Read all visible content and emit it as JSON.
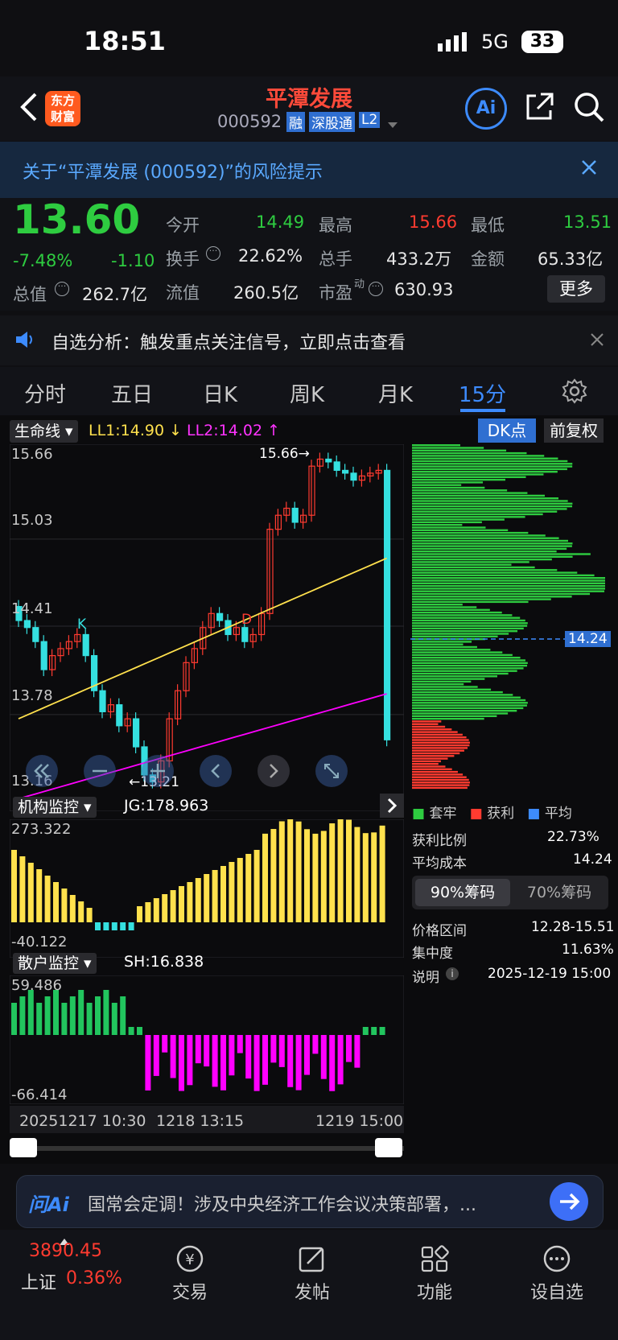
{
  "status": {
    "time": "18:51",
    "network": "5G",
    "battery": "33"
  },
  "header": {
    "logo_line1": "东方",
    "logo_line2": "财富",
    "title": "平潭发展",
    "code": "000592",
    "tag_margin": "融",
    "tag_connect": "深股通",
    "tag_level": "L2",
    "ai_label": "Ai"
  },
  "banner": {
    "text": "关于“平潭发展 (000592)”的风险提示"
  },
  "quote": {
    "price": "13.60",
    "change_pct": "-7.48%",
    "change": "-1.10",
    "open_label": "今开",
    "open": "14.49",
    "high_label": "最高",
    "high": "15.66",
    "low_label": "最低",
    "low": "13.51",
    "turnover_label": "换手",
    "turnover": "22.62%",
    "volume_label": "总手",
    "volume": "433.2万",
    "amount_label": "金额",
    "amount": "65.33亿",
    "mcap_label": "总值",
    "mcap": "262.7亿",
    "float_label": "流值",
    "float": "260.5亿",
    "pe_label": "市盈",
    "pe_sup": "动",
    "pe": "630.93",
    "more": "更多"
  },
  "notice": {
    "text": "自选分析：触发重点关注信号，立即点击查看"
  },
  "tabs": [
    "分时",
    "五日",
    "日K",
    "周K",
    "月K",
    "15分"
  ],
  "chart": {
    "indicator": "生命线",
    "ll1": "LL1:14.90",
    "ll2": "LL2:14.02",
    "dk": "DK点",
    "adjust": "前复权",
    "y_labels": [
      "15.66",
      "15.03",
      "14.41",
      "13.78",
      "13.16"
    ],
    "high_mark": "15.66",
    "low_mark": "13.21",
    "marker_k": "K",
    "marker_d": "D",
    "cost_tag": "14.24"
  },
  "chart_data": {
    "type": "candlestick",
    "y_range": [
      13.16,
      15.66
    ],
    "institution": {
      "name": "机构监控",
      "value": "JG:178.963",
      "max": "273.322",
      "min": "-40.122"
    },
    "retail": {
      "name": "散户监控",
      "value": "SH:16.838",
      "max": "59.486",
      "min": "-66.414"
    },
    "x_labels": [
      "20251217 10:30",
      "1218 13:15",
      "1219 15:00"
    ]
  },
  "chips": {
    "legend": [
      "套牢",
      "获利",
      "平均"
    ],
    "rows": [
      {
        "k": "获利比例",
        "v": "22.73%"
      },
      {
        "k": "平均成本",
        "v": "14.24"
      }
    ],
    "tab90": "90%筹码",
    "tab70": "70%筹码",
    "rows2": [
      {
        "k": "价格区间",
        "v": "12.28-15.51"
      },
      {
        "k": "集中度",
        "v": "11.63%"
      },
      {
        "k": "说明",
        "v": "2025-12-19 15:00"
      }
    ]
  },
  "ai_bar": {
    "brand": "问Ai",
    "text": "国常会定调！涉及中央经济工作会议决策部署，..."
  },
  "nav": {
    "index_value": "3890.45",
    "index_name": "上证",
    "index_pct": "0.36%",
    "trade": "交易",
    "post": "发帖",
    "func": "功能",
    "fav": "设自选"
  },
  "colors": {
    "up": "#ff3b30",
    "down": "#2ecc40",
    "accent": "#3d8bfd",
    "cyan": "#35e0e0",
    "yellow": "#ffe14d",
    "magenta": "#ff00ff"
  }
}
